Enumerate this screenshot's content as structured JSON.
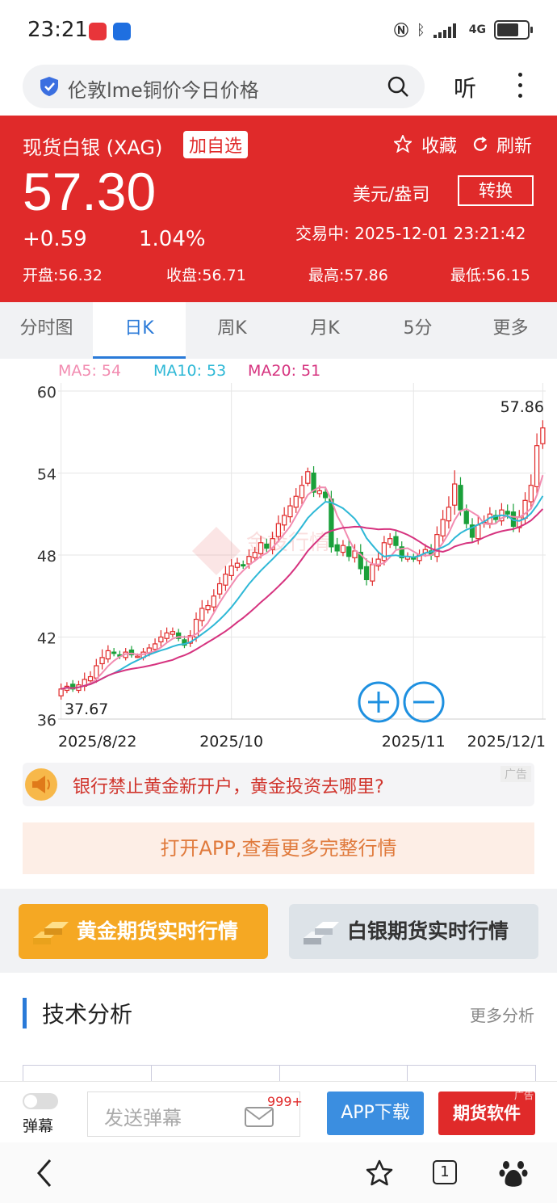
{
  "status_bar": {
    "time": "23:21",
    "network": "4G",
    "battery_level": 0.75
  },
  "search": {
    "query": "伦敦lme铜价今日价格",
    "listen_label": "听"
  },
  "quote": {
    "name": "现货白银 (XAG)",
    "add_fav_label": "加自选",
    "collect_label": "收藏",
    "refresh_label": "刷新",
    "price": "57.30",
    "unit": "美元/盎司",
    "convert_label": "转换",
    "change": "+0.59",
    "change_pct": "1.04%",
    "trading_status": "交易中: 2025-12-01 23:21:42",
    "open": "开盘:56.32",
    "close": "收盘:56.71",
    "high": "最高:57.86",
    "low": "最低:56.15"
  },
  "tabs": [
    "分时图",
    "日K",
    "周K",
    "月K",
    "5分",
    "更多"
  ],
  "chart_data": {
    "type": "candlestick",
    "ma_labels": [
      "MA5: 54",
      "MA10: 53",
      "MA20: 51"
    ],
    "ma_colors": [
      "#f28cb1",
      "#2eb8d6",
      "#d6337f"
    ],
    "y_ticks": [
      "60",
      "54",
      "48",
      "42",
      "36"
    ],
    "ylim": [
      36,
      60
    ],
    "x_ticks": [
      "2025/8/22",
      "2025/10",
      "2025/11",
      "2025/12/1"
    ],
    "max_label": "57.86",
    "min_label": "37.67",
    "up_color": "#e02a2a",
    "down_color": "#1aa03a",
    "closes": [
      38.2,
      38.4,
      38.2,
      38.5,
      38.9,
      39.1,
      39.9,
      40.5,
      41.0,
      40.8,
      40.6,
      40.9,
      40.7,
      40.6,
      40.9,
      41.2,
      41.5,
      42.0,
      42.3,
      42.4,
      41.9,
      41.4,
      42.1,
      43.3,
      44.1,
      44.3,
      45.0,
      45.9,
      46.6,
      47.2,
      47.4,
      47.2,
      47.9,
      48.2,
      48.9,
      48.5,
      49.2,
      50.3,
      50.9,
      51.6,
      52.3,
      53.1,
      54.1,
      52.6,
      52.7,
      52.2,
      48.6,
      48.3,
      48.7,
      47.9,
      48.3,
      47.0,
      46.2,
      47.3,
      47.7,
      48.9,
      49.2,
      48.7,
      47.8,
      47.9,
      47.7,
      48.0,
      48.4,
      48.0,
      49.5,
      50.6,
      51.5,
      53.2,
      51.3,
      50.3,
      49.3,
      50.2,
      50.4,
      51.0,
      50.6,
      51.3,
      51.0,
      50.1,
      50.8,
      52.0,
      53.1,
      56.0,
      57.3
    ],
    "highs_extra": [
      0.4,
      0.3,
      0.3,
      0.3,
      0.5,
      0.4,
      0.5,
      0.6,
      0.4,
      0.3,
      0.3,
      0.3,
      0.3,
      0.2,
      0.3,
      0.3,
      0.4,
      0.5,
      0.4,
      0.3,
      0.3,
      0.3,
      0.4,
      0.5,
      0.6,
      0.4,
      0.5,
      0.5,
      0.6,
      0.5,
      0.4,
      0.3,
      0.5,
      0.4,
      0.5,
      0.4,
      0.5,
      0.6,
      0.6,
      0.6,
      0.6,
      0.7,
      0.3,
      0.5,
      0.4,
      0.4,
      0.6,
      0.5,
      0.4,
      0.5,
      0.5,
      0.6,
      0.6,
      0.5,
      0.5,
      0.5,
      0.4,
      0.4,
      0.4,
      0.3,
      0.3,
      0.4,
      0.4,
      0.5,
      0.6,
      0.7,
      0.8,
      1.0,
      0.6,
      0.5,
      0.5,
      0.6,
      0.5,
      0.5,
      0.4,
      0.5,
      0.5,
      0.6,
      0.5,
      0.6,
      0.8,
      0.9,
      0.56
    ]
  },
  "watermark": "金投行情",
  "ad": {
    "text": "银行禁止黄金新开户，黄金投资去哪里?",
    "tag": "广告"
  },
  "open_app_label": "打开APP,查看更多完整行情",
  "gold_futures_label": "黄金期货实时行情",
  "silver_futures_label": "白银期货实时行情",
  "tech": {
    "title": "技术分析",
    "more": "更多分析"
  },
  "bottom": {
    "danmu_label": "弹幕",
    "danmu_placeholder": "发送弹幕",
    "danmu_count": "999+",
    "app_download": "APP下载",
    "futures_software": "期货软件",
    "futures_tag": "广告"
  },
  "nav": {
    "tab_count": "1"
  }
}
